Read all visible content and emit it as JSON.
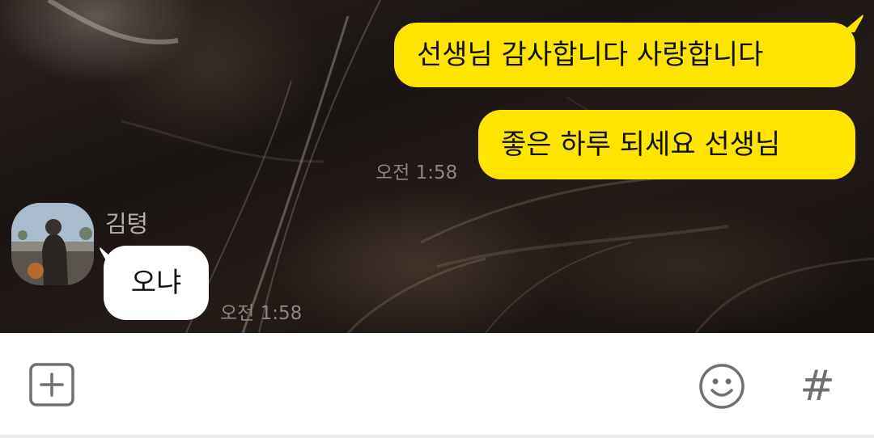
{
  "messages": {
    "sent": [
      {
        "text": "선생님 감사합니다 사랑합니다"
      },
      {
        "text": "좋은 하루 되세요 선생님",
        "time": "오전 1:58"
      }
    ],
    "received": {
      "sender": "김텽",
      "text": "오냐",
      "time": "오전 1:58"
    }
  },
  "input_bar": {
    "add_icon": "plus-square-icon",
    "emoji_icon": "smiley-icon",
    "hashtag_icon": "hashtag-icon",
    "hashtag_glyph": "#",
    "message_value": ""
  },
  "colors": {
    "my_bubble": "#fee500",
    "other_bubble": "#ffffff",
    "timestamp": "#8d8580",
    "sender_name": "#b5aea8",
    "icon": "#707070"
  }
}
